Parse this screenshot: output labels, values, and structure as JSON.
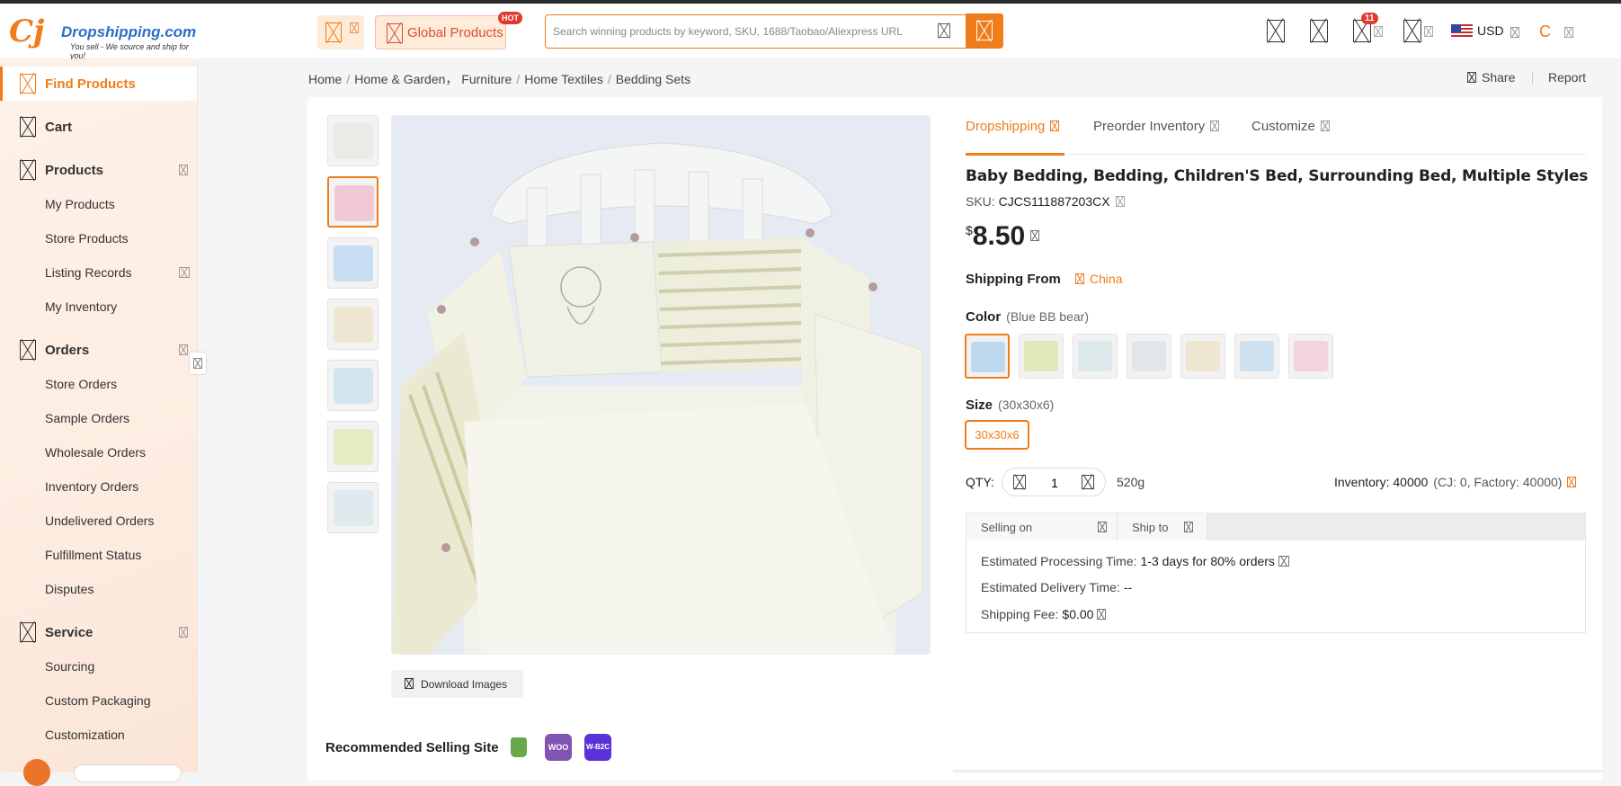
{
  "header": {
    "logo_name": "Dropshipping.com",
    "logo_tagline": "You sell - We source and ship for you!",
    "global_products_label": "Global Products",
    "hot_badge": "HOT",
    "search_placeholder": "Search winning products by keyword, SKU, 1688/Taobao/Aliexpress URL",
    "notifications_count": "11",
    "currency": "USD",
    "avatar_letter": "C"
  },
  "sidebar": {
    "find_products": "Find Products",
    "cart": "Cart",
    "products": "Products",
    "products_items": [
      "My Products",
      "Store Products",
      "Listing Records",
      "My Inventory"
    ],
    "orders": "Orders",
    "orders_items": [
      "Store Orders",
      "Sample Orders",
      "Wholesale Orders",
      "Inventory Orders",
      "Undelivered Orders",
      "Fulfillment Status",
      "Disputes"
    ],
    "service": "Service",
    "service_items": [
      "Sourcing",
      "Custom Packaging",
      "Customization"
    ]
  },
  "breadcrumb": [
    "Home",
    "Home & Garden， Furniture",
    "Home Textiles",
    "Bedding Sets"
  ],
  "actions": {
    "share": "Share",
    "report": "Report"
  },
  "gallery": {
    "download_label": "Download Images"
  },
  "tabs": [
    "Dropshipping",
    "Preorder Inventory",
    "Customize"
  ],
  "product": {
    "title": "Baby Bedding, Bedding, Children'S Bed, Surrounding Bed, Multiple Styles",
    "sku_label": "SKU:",
    "sku": "CJCS111887203CX",
    "currency_symbol": "$",
    "price": "8.50",
    "shipping_from_label": "Shipping From",
    "shipping_from": "China",
    "color_label": "Color",
    "color_selected": "(Blue BB bear)",
    "size_label": "Size",
    "size_selected": "(30x30x6)",
    "size_option": "30x30x6",
    "qty_label": "QTY:",
    "qty_value": "1",
    "weight": "520g",
    "inventory": "Inventory: 40000",
    "inventory_detail": "(CJ: 0, Factory: 40000)"
  },
  "shipping": {
    "selling_on_label": "Selling on",
    "ship_to_label": "Ship to",
    "processing_label": "Estimated Processing Time:",
    "processing_value": "1-3 days for 80% orders",
    "delivery_label": "Estimated Delivery Time:",
    "delivery_value": "--",
    "fee_label": "Shipping Fee:",
    "fee_value": "$0.00"
  },
  "recommended": {
    "label": "Recommended Selling Site",
    "sites": [
      "Shopify",
      "WOO",
      "WIX"
    ],
    "woo_text": "WOO",
    "wix_text": "W-B2C"
  },
  "colors": {
    "accent": "#f07c1a",
    "swatches": [
      "#bcd9ee",
      "#dfe8b8",
      "#dde9ea",
      "#e2e6ea",
      "#efe6d2",
      "#cfe1ef",
      "#f3d3df"
    ],
    "thumbs": [
      "#e9ebe6",
      "#f1c9d6",
      "#c7def2",
      "#efe7d3",
      "#d3e6ef",
      "#e3ecc3",
      "#dfeaee"
    ]
  }
}
